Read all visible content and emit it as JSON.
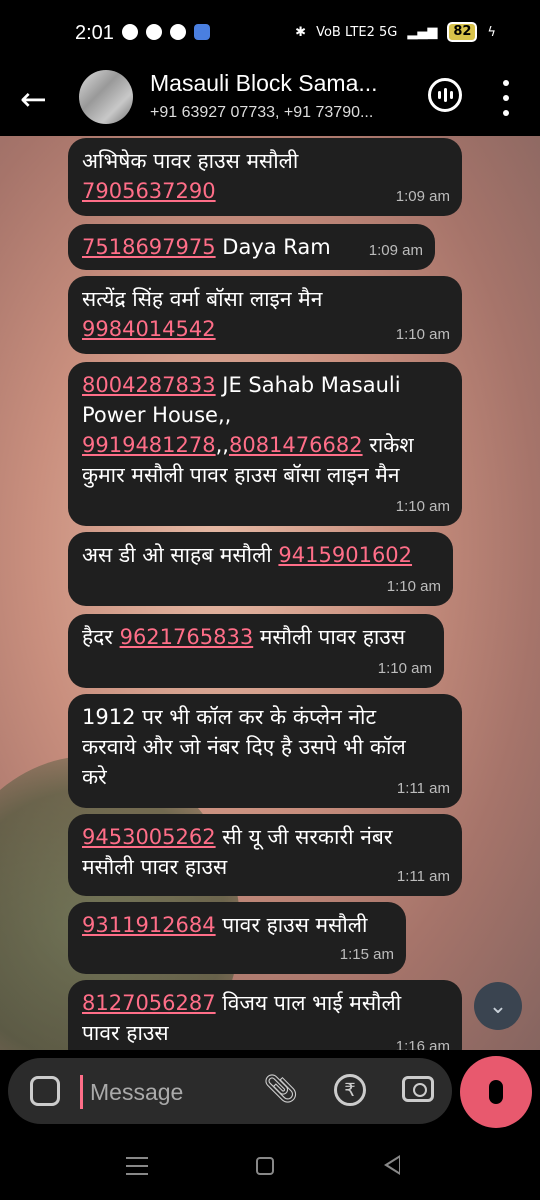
{
  "status": {
    "time": "2:01",
    "network": "VoB LTE2 5G",
    "battery": "82"
  },
  "header": {
    "title": "Masauli Block Sama...",
    "subtitle": "+91 63927 07733, +91 73790..."
  },
  "messages": [
    {
      "pre": "अभिषेक पावर हाउस मसौली\n",
      "phone": "7905637290",
      "post": "",
      "time": "1:09 am"
    },
    {
      "pre": "",
      "phone": "7518697975",
      "post": " Daya Ram",
      "time": "1:09 am"
    },
    {
      "pre": "सत्येंद्र सिंह वर्मा बॉसा लाइन मैन\n",
      "phone": "9984014542",
      "post": "",
      "time": "1:10 am"
    },
    {
      "pre": "",
      "phone": "8004287833",
      "post": " JE Sahab Masauli\nPower House,,\n",
      "phone2": "9919481278",
      "mid": ",,",
      "phone3": "8081476682",
      "post2": " राकेश\nकुमार मसौली पावर हाउस बॉसा लाइन मैन",
      "time": "1:10 am"
    },
    {
      "pre": "अस डी ओ साहब मसौली ",
      "phone": "9415901602",
      "post": "",
      "time": "1:10 am"
    },
    {
      "pre": "हैदर ",
      "phone": "9621765833",
      "post": " मसौली पावर हाउस",
      "time": "1:10 am"
    },
    {
      "pre": "1912 पर भी कॉल कर के कंप्लेन नोट\nकरवाये और जो नंबर दिए है उसपे भी कॉल\nकरे",
      "phone": "",
      "post": "",
      "time": "1:11 am"
    },
    {
      "pre": "",
      "phone": "9453005262",
      "post": " सी यू जी सरकारी नंबर\nमसौली पावर हाउस",
      "time": "1:11 am"
    },
    {
      "pre": "",
      "phone": "9311912684",
      "post": " पावर हाउस मसौली",
      "time": "1:15 am"
    },
    {
      "pre": "",
      "phone": "8127056287",
      "post": " विजय पाल भाई मसौली\nपावर हाउस",
      "time": "1:16 am"
    }
  ],
  "composer": {
    "placeholder": "Message"
  },
  "colors": {
    "bubble": "#1f1f1f",
    "link": "#ff6e88",
    "voice_button": "#e8596e"
  }
}
